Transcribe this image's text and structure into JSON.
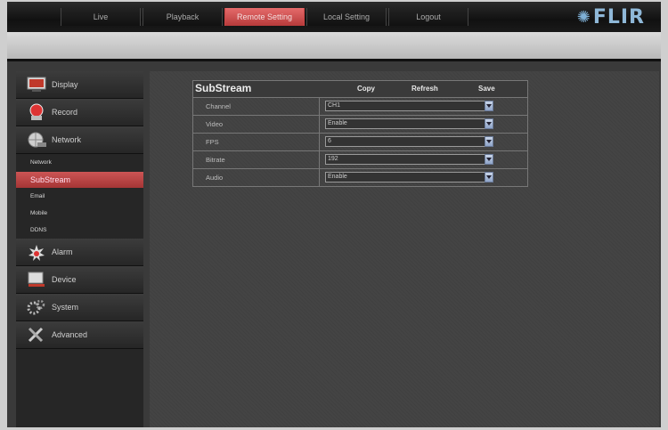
{
  "nav": {
    "items": [
      {
        "label": "Live"
      },
      {
        "label": "Playback"
      },
      {
        "label": "Remote Setting"
      },
      {
        "label": "Local Setting"
      },
      {
        "label": "Logout"
      }
    ],
    "active": "Remote Setting"
  },
  "logo": {
    "text": "FLIR"
  },
  "sidebar": {
    "items": [
      {
        "label": "Display",
        "icon": "monitor-icon"
      },
      {
        "label": "Record",
        "icon": "record-icon"
      },
      {
        "label": "Network",
        "icon": "globe-icon"
      },
      {
        "label": "Alarm",
        "icon": "alarm-icon"
      },
      {
        "label": "Device",
        "icon": "device-icon"
      },
      {
        "label": "System",
        "icon": "gears-icon"
      },
      {
        "label": "Advanced",
        "icon": "tools-icon"
      }
    ],
    "subitems": [
      {
        "label": "Network"
      },
      {
        "label": "SubStream"
      },
      {
        "label": "Email"
      },
      {
        "label": "Mobile"
      },
      {
        "label": "DDNS"
      }
    ],
    "active_sub": "SubStream"
  },
  "panel": {
    "title": "SubStream",
    "actions": {
      "copy": "Copy",
      "refresh": "Refresh",
      "save": "Save"
    },
    "rows": [
      {
        "label": "Channel",
        "value": "CH1"
      },
      {
        "label": "Video",
        "value": "Enable"
      },
      {
        "label": "FPS",
        "value": "6"
      },
      {
        "label": "Bitrate",
        "value": "192"
      },
      {
        "label": "Audio",
        "value": "Enable"
      }
    ]
  },
  "colors": {
    "accent": "#c94a4a",
    "logo": "#8fb8d8"
  }
}
